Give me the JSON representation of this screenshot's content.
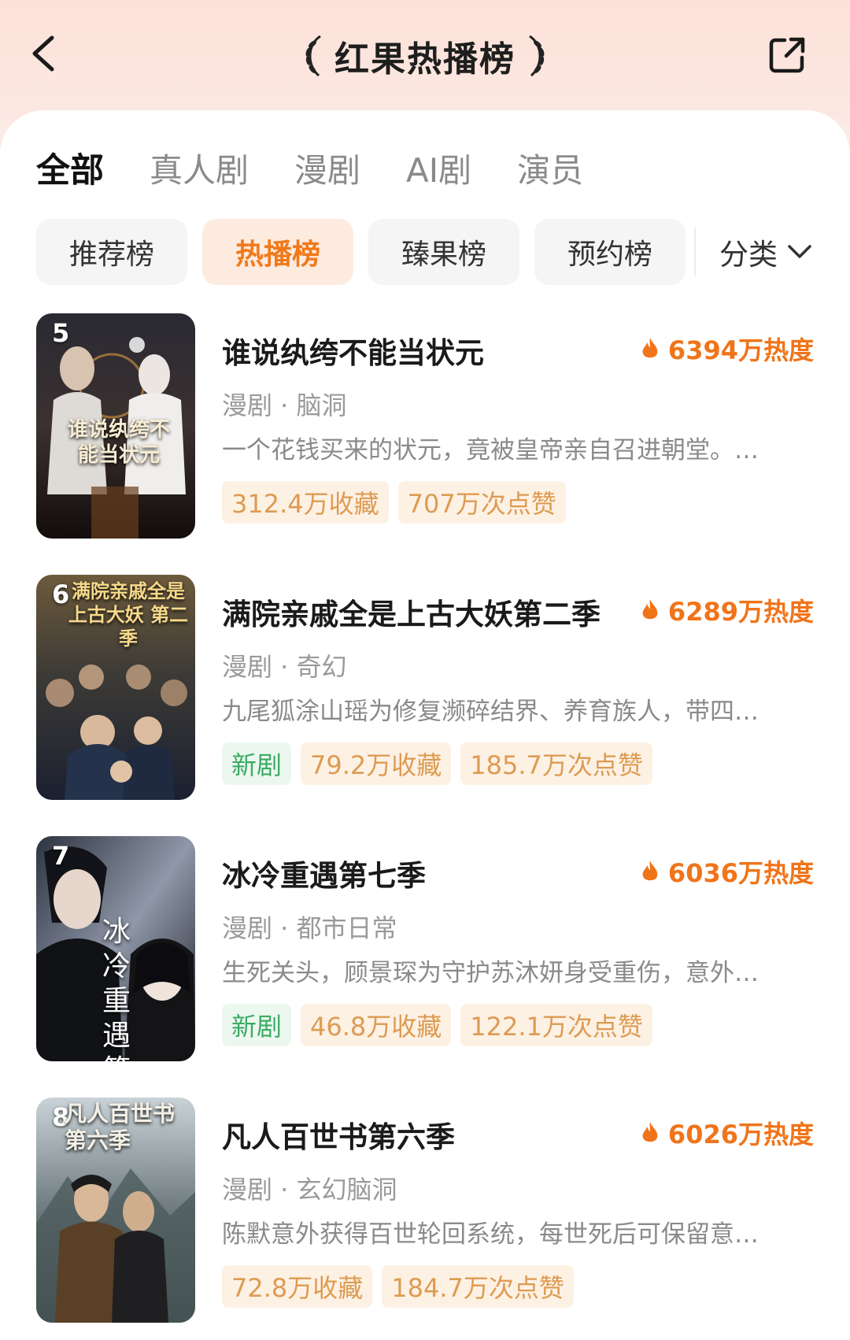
{
  "header": {
    "title": "红果热播榜",
    "back_icon": "chevron-left-icon",
    "share_icon": "share-icon"
  },
  "tabs": [
    {
      "label": "全部",
      "active": true
    },
    {
      "label": "真人剧",
      "active": false
    },
    {
      "label": "漫剧",
      "active": false
    },
    {
      "label": "AI剧",
      "active": false
    },
    {
      "label": "演员",
      "active": false
    }
  ],
  "chips": [
    {
      "label": "推荐榜",
      "active": false
    },
    {
      "label": "热播榜",
      "active": true
    },
    {
      "label": "臻果榜",
      "active": false
    },
    {
      "label": "预约榜",
      "active": false
    }
  ],
  "category": {
    "label": "分类",
    "icon": "chevron-down-icon"
  },
  "colors": {
    "accent": "#f0741a",
    "tag_bg": "#fdf1e4",
    "tag_text": "#dd9b52",
    "new_bg": "#ecf8ef",
    "new_text": "#3bab63"
  },
  "items": [
    {
      "rank": "5",
      "title": "谁说纨绔不能当状元",
      "cover_title": "谁说纨绔不能当状元",
      "heat": "6394万热度",
      "meta": "漫剧 · 脑洞",
      "desc": "一个花钱买来的状元，竟被皇帝亲自召进朝堂。…",
      "badge": "",
      "favorites": "312.4万收藏",
      "likes": "707万次点赞"
    },
    {
      "rank": "6",
      "title": "满院亲戚全是上古大妖第二季",
      "cover_title": "满院亲戚全是上古大妖 第二季",
      "heat": "6289万热度",
      "meta": "漫剧 · 奇幻",
      "desc": "九尾狐涂山瑶为修复濒碎结界、养育族人，带四…",
      "badge": "新剧",
      "favorites": "79.2万收藏",
      "likes": "185.7万次点赞"
    },
    {
      "rank": "7",
      "title": "冰冷重遇第七季",
      "cover_title": "冰冷重遇 第七季",
      "heat": "6036万热度",
      "meta": "漫剧 · 都市日常",
      "desc": "生死关头，顾景琛为守护苏沐妍身受重伤，意外…",
      "badge": "新剧",
      "favorites": "46.8万收藏",
      "likes": "122.1万次点赞"
    },
    {
      "rank": "8",
      "title": "凡人百世书第六季",
      "cover_title": "凡人百世书 第六季",
      "heat": "6026万热度",
      "meta": "漫剧 · 玄幻脑洞",
      "desc": "陈默意外获得百世轮回系统，每世死后可保留意…",
      "badge": "",
      "favorites": "72.8万收藏",
      "likes": "184.7万次点赞"
    }
  ]
}
